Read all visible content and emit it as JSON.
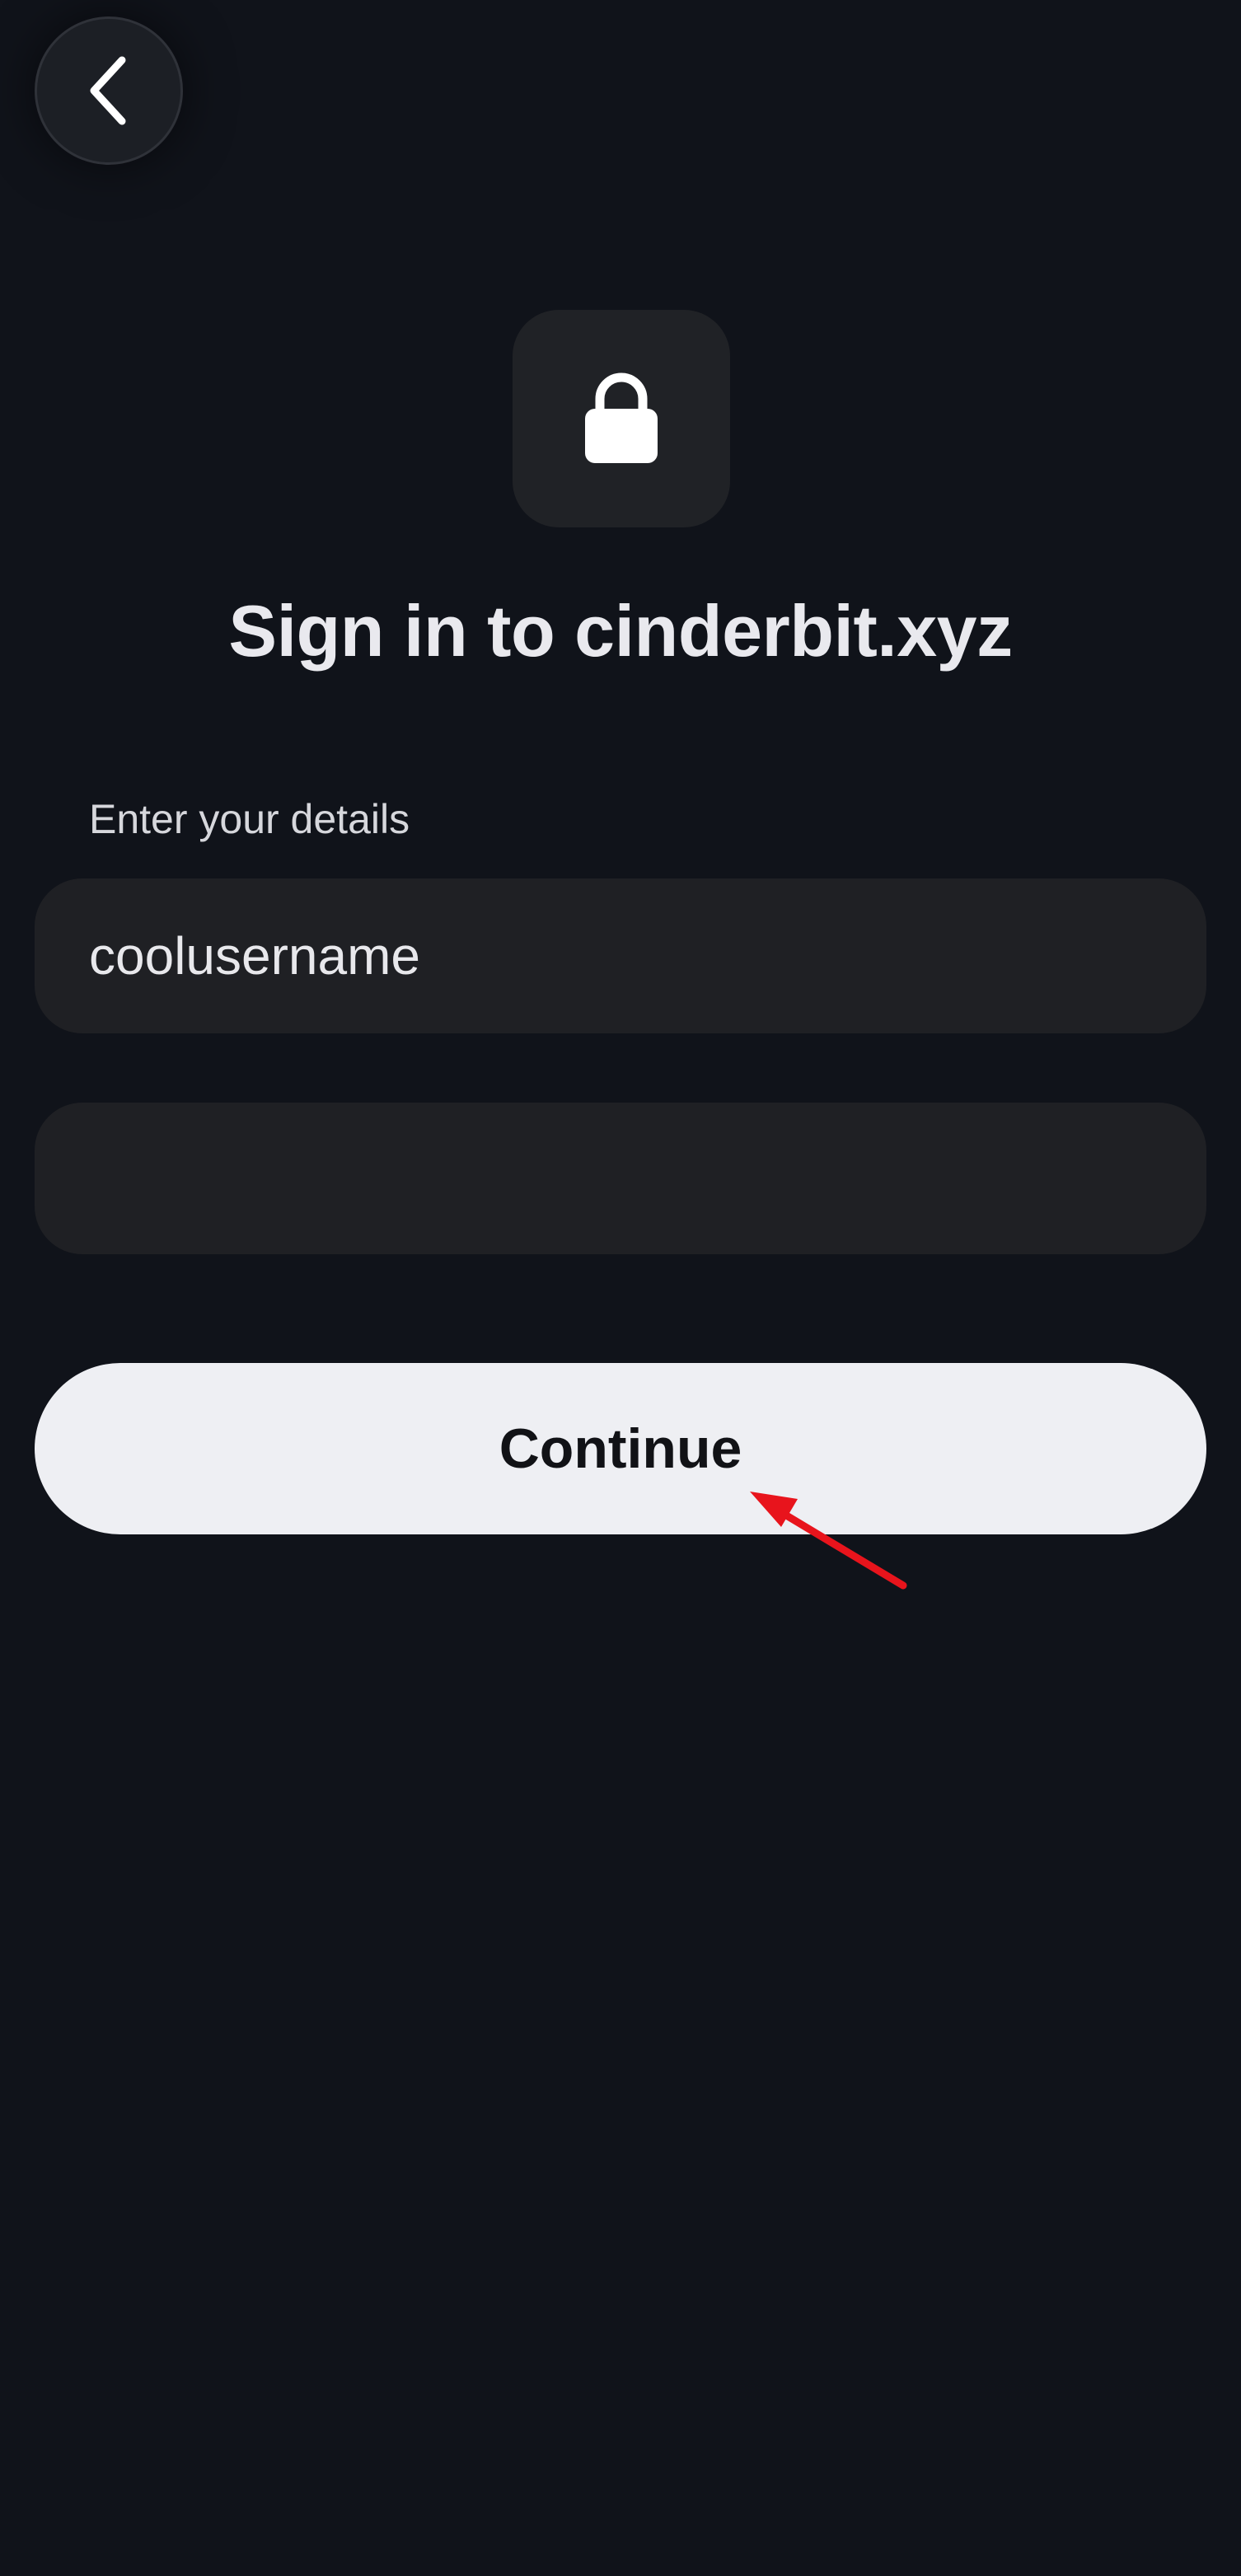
{
  "header": {
    "back_icon": "chevron-left-icon"
  },
  "hero": {
    "icon": "lock-icon",
    "title": "Sign in to cinderbit.xyz"
  },
  "form": {
    "label": "Enter your details",
    "username": {
      "value": "coolusername"
    },
    "password": {
      "value": ""
    },
    "continue_label": "Continue"
  },
  "annotation": {
    "type": "arrow",
    "color": "#e8141c",
    "target": "continue-button"
  },
  "colors": {
    "background": "#10131a",
    "field_background": "#1f2024",
    "button_background": "#eeeff3"
  }
}
